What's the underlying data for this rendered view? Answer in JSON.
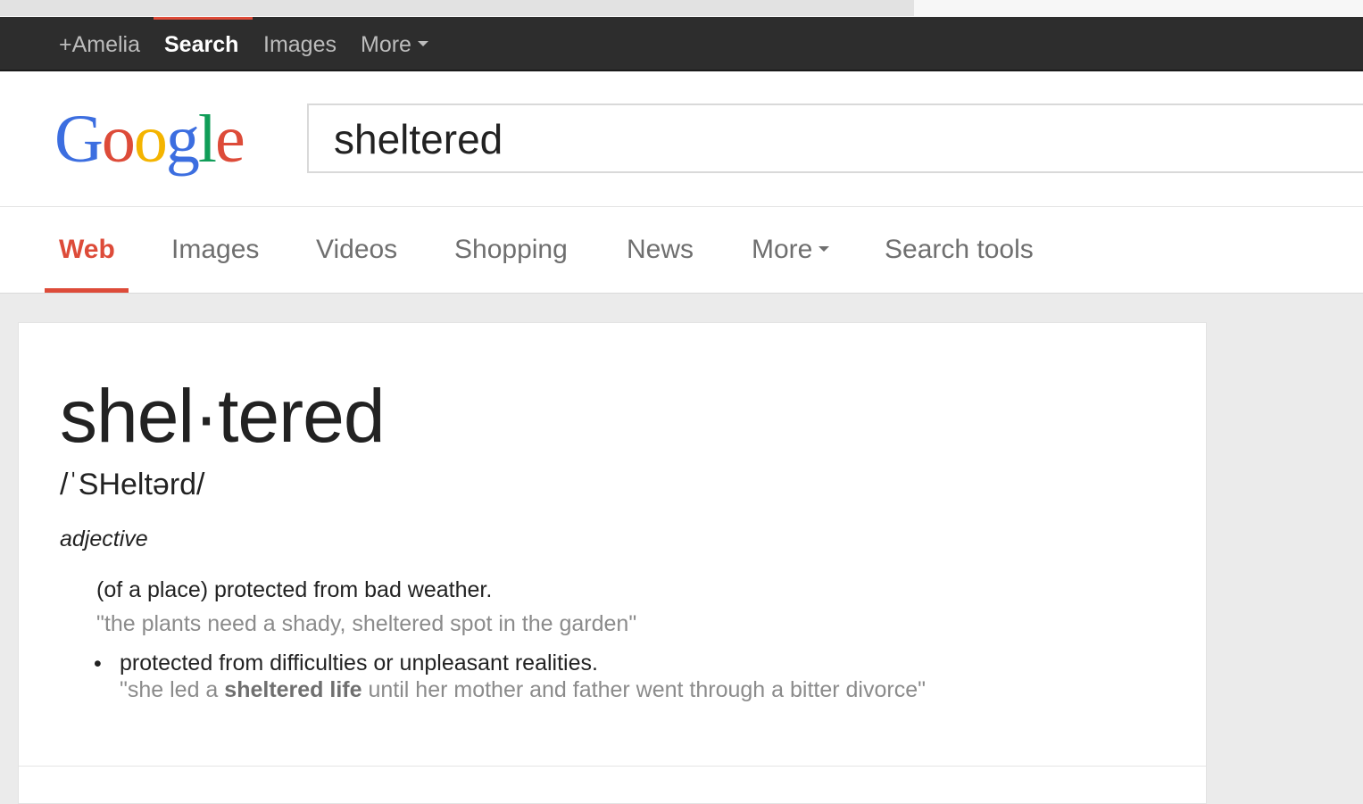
{
  "topbar": {
    "items": [
      {
        "label": "+Amelia"
      },
      {
        "label": "Search"
      },
      {
        "label": "Images"
      },
      {
        "label": "More"
      }
    ]
  },
  "logo": {
    "letters": [
      "G",
      "o",
      "o",
      "g",
      "l",
      "e"
    ]
  },
  "search": {
    "query": "sheltered"
  },
  "tabs": [
    {
      "label": "Web"
    },
    {
      "label": "Images"
    },
    {
      "label": "Videos"
    },
    {
      "label": "Shopping"
    },
    {
      "label": "News"
    },
    {
      "label": "More"
    },
    {
      "label": "Search tools"
    }
  ],
  "definition": {
    "word": "shel·tered",
    "phonetic": "/ˈSHeltərd/",
    "part_of_speech": "adjective",
    "sense1": "(of a place) protected from bad weather.",
    "example1": "\"the plants need a shady, sheltered spot in the garden\"",
    "bullet": "•",
    "sense2": "protected from difficulties or unpleasant realities.",
    "example2_pre": "\"she led a ",
    "example2_bold": "sheltered life",
    "example2_post": " until her mother and father went through a bitter divorce\""
  },
  "colors": {
    "accent": "#dd4b39",
    "topbar_bg": "#2d2d2d",
    "google_blue": "#3c6ee0",
    "google_red": "#dd4b39",
    "google_yellow": "#f4b400",
    "google_green": "#109d58"
  }
}
